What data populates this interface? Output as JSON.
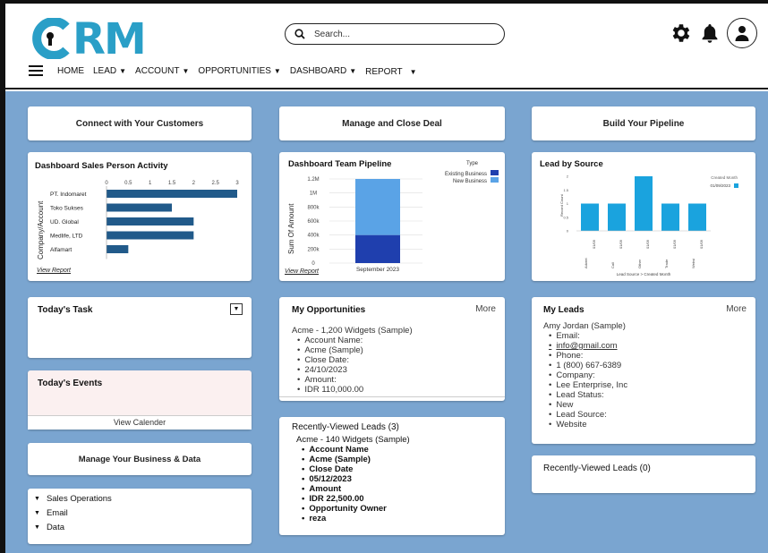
{
  "brand": {
    "logo_text": "CRM",
    "accent": "#2a9fc7"
  },
  "search": {
    "placeholder": "Search..."
  },
  "icons": {
    "settings": "gear-icon",
    "notifications": "bell-icon",
    "profile": "user-icon",
    "menu": "hamburger-icon"
  },
  "nav": {
    "items": [
      {
        "label": "HOME",
        "dropdown": false
      },
      {
        "label": "LEAD",
        "dropdown": true
      },
      {
        "label": "ACCOUNT",
        "dropdown": true
      },
      {
        "label": "OPPORTUNITIES",
        "dropdown": true
      },
      {
        "label": "DASHBOARD",
        "dropdown": true
      },
      {
        "label": "REPORT",
        "dropdown": true
      }
    ]
  },
  "buttons": {
    "connect": "Connect with Your Customers",
    "manage_deal": "Manage and Close Deal",
    "build_pipeline": "Build Your Pipeline",
    "manage_business": "Manage Your Business & Data"
  },
  "sales_activity": {
    "title": "Dashboard Sales Person Activity",
    "view_report": "View Report",
    "chart_data": {
      "type": "bar",
      "orientation": "horizontal",
      "title": "Dashboard Sales Person Activity",
      "ylabel": "Company/Account",
      "categories": [
        "PT. Indomaret",
        "Toko Sukses",
        "UD. Global",
        "Medlife, LTD",
        "Alfamart"
      ],
      "values": [
        3,
        1.5,
        2,
        2,
        0.5
      ],
      "xticks": [
        "0",
        "0.5",
        "1",
        "1.5",
        "2",
        "2.5",
        "3"
      ],
      "xlim": [
        0,
        3
      ],
      "color": "#215a8a"
    }
  },
  "team_pipeline": {
    "title": "Dashboard Team Pipeline",
    "view_report": "View Report",
    "chart_data": {
      "type": "bar",
      "stacked": true,
      "ylabel": "Sum Of Amount",
      "categories": [
        "September 2023"
      ],
      "yticks": [
        "0",
        "200k",
        "400k",
        "600k",
        "800k",
        "1M",
        "1.2M"
      ],
      "ylim": [
        0,
        1200000
      ],
      "legend_title": "Type",
      "series": [
        {
          "name": "Existing Business",
          "values": [
            400000
          ],
          "color": "#1f3fae"
        },
        {
          "name": "New Business",
          "values": [
            800000
          ],
          "color": "#5aa3e6"
        }
      ]
    }
  },
  "lead_source": {
    "title": "Lead by Source",
    "chart_data": {
      "type": "bar",
      "ylabel": "Record Count",
      "xlabel": "Lead Source > Created Month",
      "legend_title": "Created Month",
      "legend_entry": "01/09/2023",
      "categories": [
        "Advert",
        "Call",
        "Other",
        "Trade",
        "Websi"
      ],
      "sub_labels": [
        "01/09",
        "01/09",
        "01/09",
        "01/09",
        "01/09"
      ],
      "values": [
        1,
        1,
        2,
        1,
        1
      ],
      "yticks": [
        "0",
        "0.5",
        "1",
        "1.5",
        "2"
      ],
      "ylim": [
        0,
        2
      ],
      "color": "#1aa3de"
    }
  },
  "today_task": {
    "title": "Today's Task"
  },
  "today_events": {
    "title": "Today's Events",
    "calendar_link": "View Calender"
  },
  "opportunities": {
    "title": "My Opportunities",
    "more": "More",
    "name": "Acme - 1,200 Widgets (Sample)",
    "fields": [
      "Account Name:",
      "Acme (Sample)",
      "Close Date:",
      "24/10/2023",
      "Amount:",
      "IDR 110,000.00"
    ]
  },
  "recent_leads_mid": {
    "title": "Recently-Viewed Leads (3)",
    "name": "Acme - 140 Widgets (Sample)",
    "fields": [
      "Account Name",
      "Acme (Sample)",
      "Close Date",
      "05/12/2023",
      "Amount",
      "IDR 22,500.00",
      "Opportunity Owner",
      "reza"
    ]
  },
  "my_leads": {
    "title": "My Leads",
    "more": "More",
    "name": "Amy Jordan (Sample)",
    "fields": [
      "Email:",
      "info@gmail.com",
      "Phone:",
      "1 (800) 667-6389",
      "Company:",
      "Lee Enterprise, Inc",
      "Lead Status:",
      "New",
      "Lead Source:",
      "Website"
    ]
  },
  "recent_leads_right": {
    "title": "Recently-Viewed Leads (0)"
  },
  "business_menu": {
    "items": [
      "Sales Operations",
      "Email",
      "Data"
    ]
  },
  "colors": {
    "background": "#7aa5d0",
    "bar_dark": "#215a8a"
  }
}
